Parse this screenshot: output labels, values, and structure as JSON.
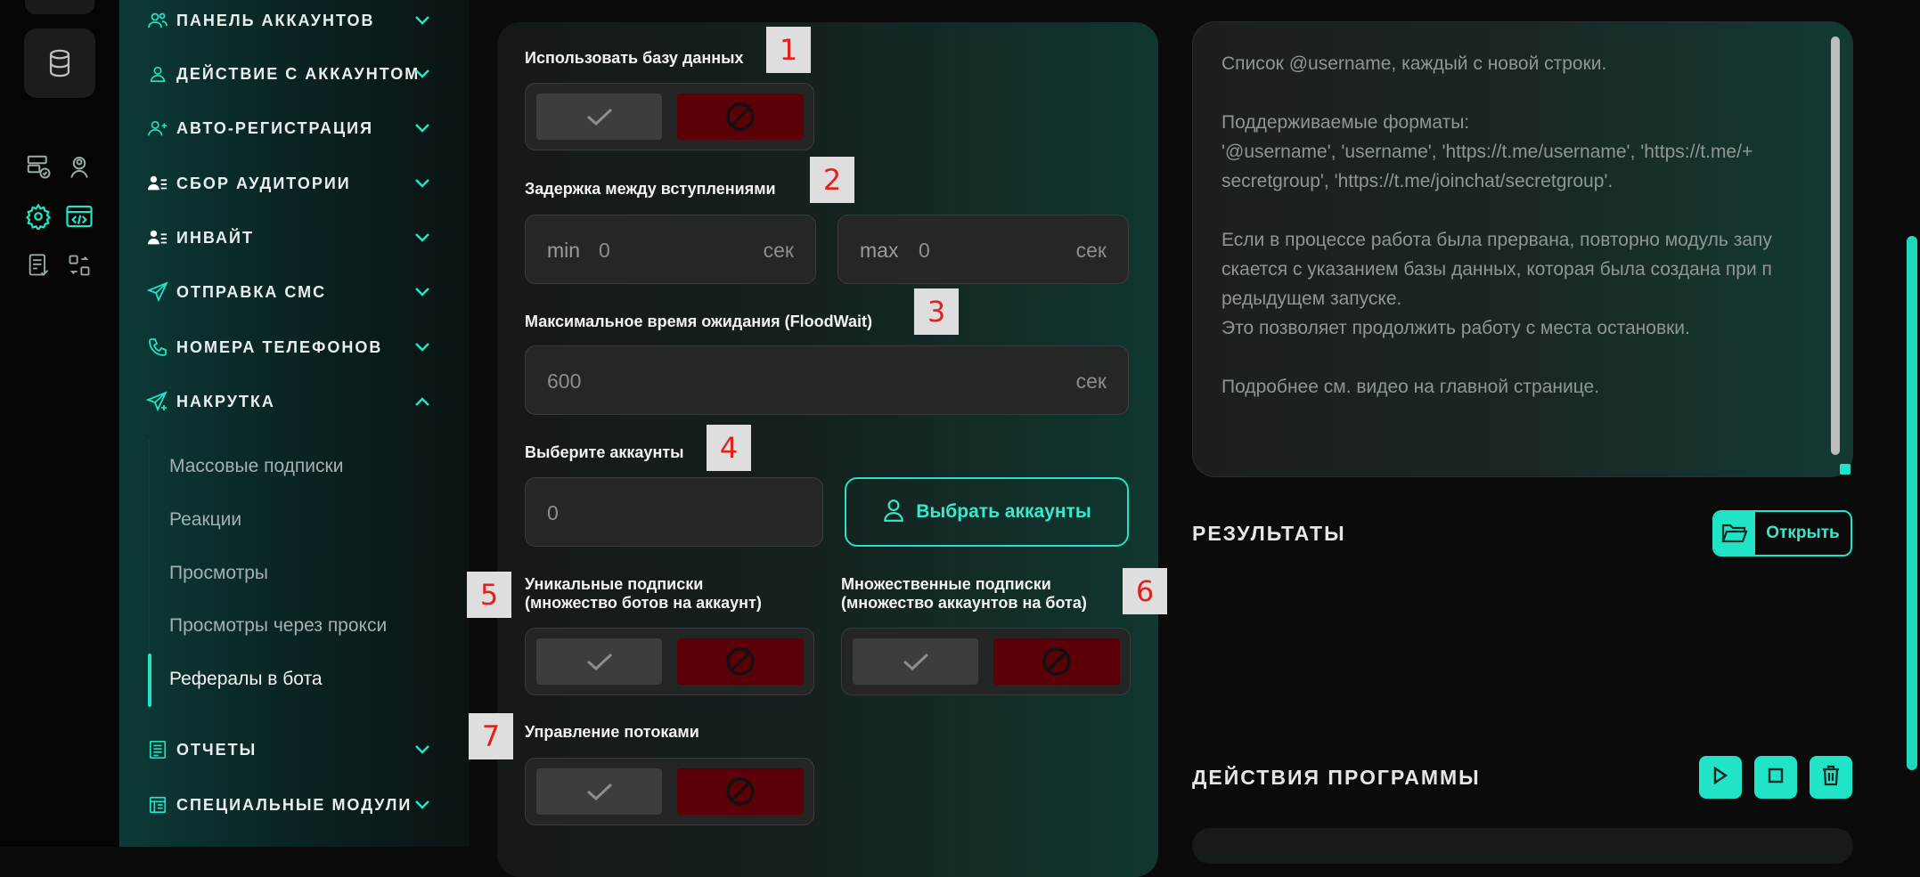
{
  "colors": {
    "accent": "#21e3c6",
    "danger": "#5c0007",
    "panel": "#151818"
  },
  "rail": {
    "icons": [
      "database-icon",
      "server-check-icon",
      "user-circle-icon",
      "gear-icon",
      "code-window-icon",
      "report-check-icon",
      "swap-grid-icon"
    ]
  },
  "sidebar": {
    "items": [
      {
        "label": "ПАНЕЛЬ АККАУНТОВ",
        "icon": "users-icon"
      },
      {
        "label": "ДЕЙСТВИЕ С АККАУНТОМ",
        "icon": "user-icon"
      },
      {
        "label": "АВТО-РЕГИСТРАЦИЯ",
        "icon": "user-plus-icon"
      },
      {
        "label": "СБОР АУДИТОРИИ",
        "icon": "user-list-icon"
      },
      {
        "label": "ИНВАЙТ",
        "icon": "user-list-icon"
      },
      {
        "label": "ОТПРАВКА СМС",
        "icon": "send-icon"
      },
      {
        "label": "НОМЕРА ТЕЛЕФОНОВ",
        "icon": "phone-icon"
      },
      {
        "label": "НАКРУТКА",
        "icon": "send-plus-icon"
      },
      {
        "label": "ОТЧЕТЫ",
        "icon": "report-icon"
      },
      {
        "label": "СПЕЦИАЛЬНЫЕ МОДУЛИ",
        "icon": "modules-icon"
      }
    ],
    "subitems": [
      "Массовые подписки",
      "Реакции",
      "Просмотры",
      "Просмотры через прокси",
      "Рефералы в бота"
    ]
  },
  "form": {
    "use_db_label": "Использовать базу данных",
    "delay_label": "Задержка между вступлениями",
    "delay_min_prefix": "min",
    "delay_min_value": "0",
    "delay_max_prefix": "max",
    "delay_max_value": "0",
    "unit_sec": "сек",
    "floodwait_label": "Максимальное время ожидания (FloodWait)",
    "floodwait_value": "600",
    "accounts_label": "Выберите аккаунты",
    "accounts_value": "0",
    "pick_accounts_button": "Выбрать аккаунты",
    "unique_label_1": "Уникальные подписки",
    "unique_label_2": "(множество ботов на аккаунт)",
    "multi_label_1": "Множественные подписки",
    "multi_label_2": "(множество аккаунтов на бота)",
    "threads_label": "Управление потоками",
    "markers": [
      "1",
      "2",
      "3",
      "4",
      "5",
      "6",
      "7"
    ]
  },
  "right": {
    "placeholder": "Список @username, каждый с новой строки.\n\nПоддерживаемые форматы:\n'@username', 'username', 'https://t.me/username', 'https://t.me/+\nsecretgroup', 'https://t.me/joinchat/secretgroup'.\n\nЕсли в процессе работа была прервана, повторно модуль запу\nскается с указанием базы данных, которая была создана при п\nредыдущем запуске.\nЭто позволяет продолжить работу с места остановки.\n\nПодробнее см. видео на главной странице.",
    "results_title": "РЕЗУЛЬТАТЫ",
    "open_button": "Открыть",
    "actions_title": "ДЕЙСТВИЯ ПРОГРАММЫ"
  }
}
